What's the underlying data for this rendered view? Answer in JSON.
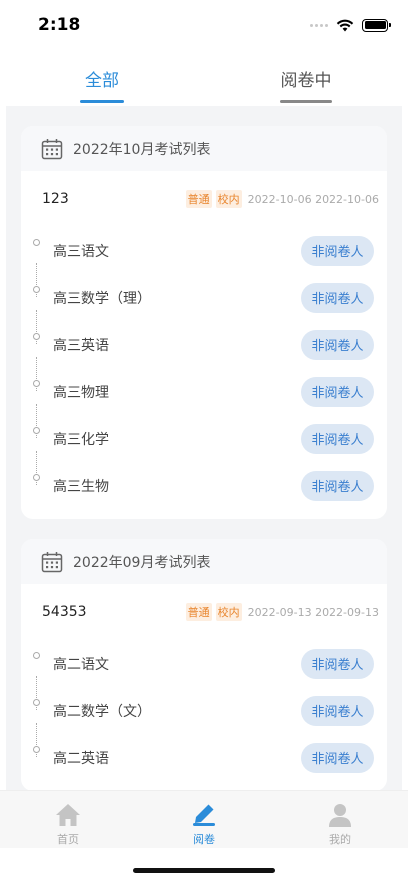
{
  "status": {
    "time": "2:18"
  },
  "tabs": [
    {
      "label": "全部",
      "active": true
    },
    {
      "label": "阅卷中",
      "active": false
    }
  ],
  "groups": [
    {
      "title": "2022年10月考试列表",
      "exam": {
        "name": "123",
        "tags": [
          "普通",
          "校内"
        ],
        "dates": "2022-10-06 2022-10-06"
      },
      "subjects": [
        {
          "name": "高三语文",
          "role": "非阅卷人"
        },
        {
          "name": "高三数学（理）",
          "role": "非阅卷人"
        },
        {
          "name": "高三英语",
          "role": "非阅卷人"
        },
        {
          "name": "高三物理",
          "role": "非阅卷人"
        },
        {
          "name": "高三化学",
          "role": "非阅卷人"
        },
        {
          "name": "高三生物",
          "role": "非阅卷人"
        }
      ]
    },
    {
      "title": "2022年09月考试列表",
      "exam": {
        "name": "54353",
        "tags": [
          "普通",
          "校内"
        ],
        "dates": "2022-09-13 2022-09-13"
      },
      "subjects": [
        {
          "name": "高二语文",
          "role": "非阅卷人"
        },
        {
          "name": "高二数学（文）",
          "role": "非阅卷人"
        },
        {
          "name": "高二英语",
          "role": "非阅卷人"
        }
      ]
    }
  ],
  "nav": [
    {
      "label": "首页",
      "icon": "home-icon",
      "active": false
    },
    {
      "label": "阅卷",
      "icon": "pen-icon",
      "active": true
    },
    {
      "label": "我的",
      "icon": "user-icon",
      "active": false
    }
  ],
  "colors": {
    "accent": "#2b8cd9",
    "tag_text": "#e8852d",
    "tag_bg": "#fdeee0",
    "button_bg": "#dce7f4"
  }
}
